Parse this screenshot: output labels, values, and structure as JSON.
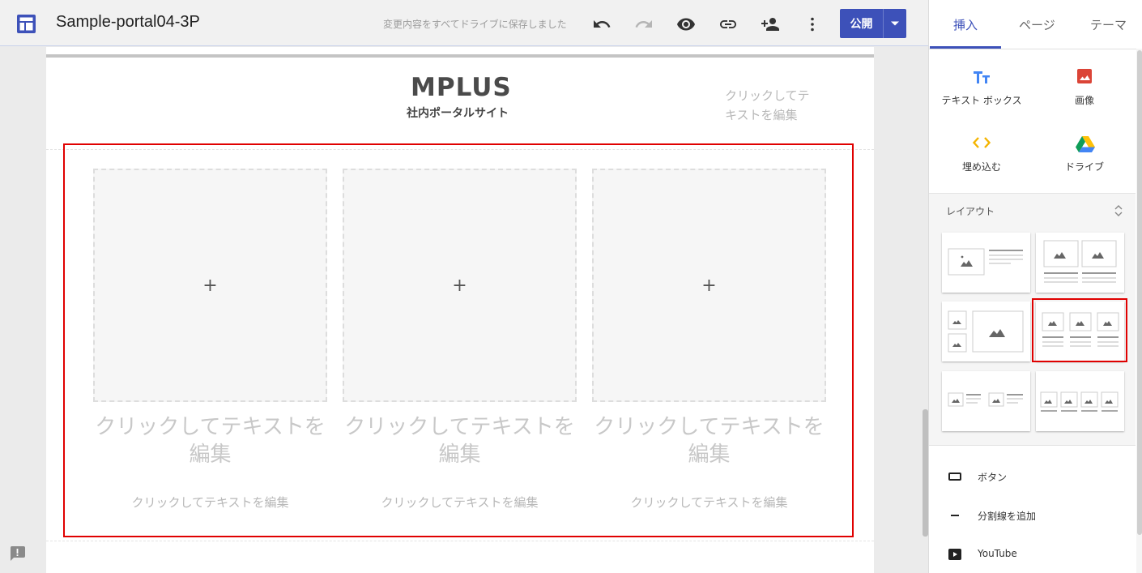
{
  "topbar": {
    "doc_title": "Sample-portal04-3P",
    "save_status": "変更内容をすべてドライブに保存しました",
    "publish_label": "公開"
  },
  "page": {
    "logo_main": "MPLUS",
    "logo_sub": "社内ポータルサイト",
    "header_text": "クリックしてテキストを編集",
    "columns": [
      {
        "plus": "+",
        "title": "クリックしてテキストを編集",
        "body": "クリックしてテキストを編集"
      },
      {
        "plus": "+",
        "title": "クリックしてテキストを編集",
        "body": "クリックしてテキストを編集"
      },
      {
        "plus": "+",
        "title": "クリックしてテキストを編集",
        "body": "クリックしてテキストを編集"
      }
    ]
  },
  "panel": {
    "tabs": [
      {
        "label": "挿入",
        "active": true
      },
      {
        "label": "ページ",
        "active": false
      },
      {
        "label": "テーマ",
        "active": false
      }
    ],
    "insert_items": [
      {
        "label": "テキスト ボックス",
        "icon": "text-box-icon"
      },
      {
        "label": "画像",
        "icon": "image-icon"
      },
      {
        "label": "埋め込む",
        "icon": "embed-icon"
      },
      {
        "label": "ドライブ",
        "icon": "drive-icon"
      }
    ],
    "layout_label": "レイアウト",
    "list_items": [
      {
        "label": "ボタン",
        "icon": "button-icon"
      },
      {
        "label": "分割線を追加",
        "icon": "divider-icon"
      },
      {
        "label": "YouTube",
        "icon": "youtube-icon"
      }
    ]
  },
  "colors": {
    "accent": "#3d51b9",
    "selection": "#e00000",
    "text_box_icon": "#4285f4",
    "image_icon": "#db4437",
    "embed_icon": "#f4b400"
  }
}
